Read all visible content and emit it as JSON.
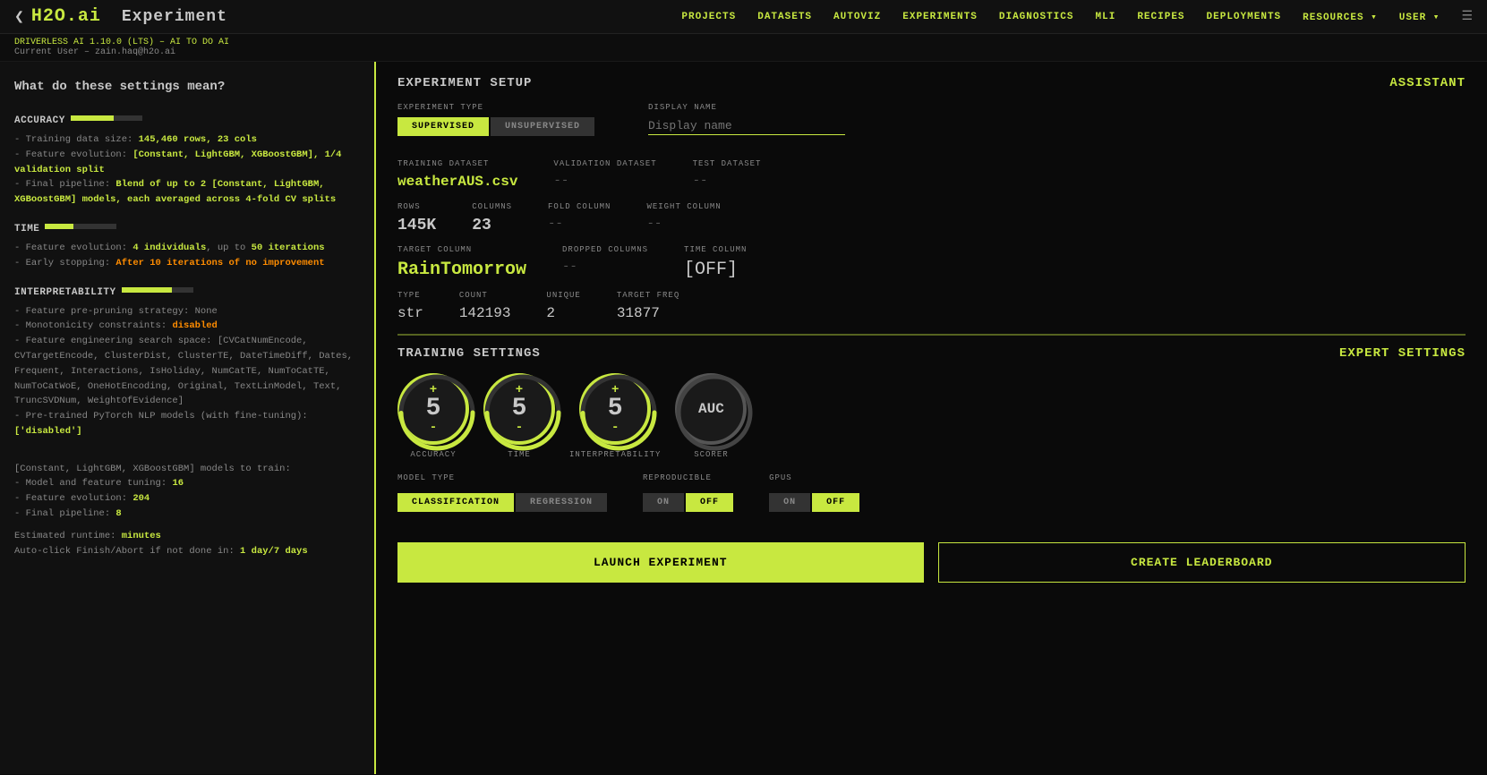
{
  "app": {
    "logo": "H2O.ai",
    "title": "Experiment",
    "version": "DRIVERLESS AI 1.10.0 (LTS) – AI TO DO AI",
    "user": "Current User – zain.haq@h2o.ai"
  },
  "nav": {
    "links": [
      "PROJECTS",
      "DATASETS",
      "AUTOVIZ",
      "EXPERIMENTS",
      "DIAGNOSTICS",
      "MLI",
      "RECIPES",
      "DEPLOYMENTS",
      "RESOURCES ▾",
      "USER ▾"
    ]
  },
  "left_panel": {
    "heading": "What do these settings mean?",
    "accuracy": {
      "label": "ACCURACY",
      "bar_pct": 60,
      "bullets": [
        "Training data size: 145,460 rows, 23 cols",
        "Feature evolution: [Constant, LightGBM, XGBoostGBM], 1/4 validation split",
        "Final pipeline: Blend of up to 2 [Constant, LightGBM, XGBoostGBM] models, each averaged across 4-fold CV splits"
      ]
    },
    "time": {
      "label": "TIME",
      "bar_pct": 40,
      "bullets": [
        "Feature evolution: 4 individuals, up to 50 iterations",
        "Early stopping: After 10 iterations of no improvement"
      ]
    },
    "interpretability": {
      "label": "INTERPRETABILITY",
      "bar_pct": 70,
      "bullets": [
        "Feature pre-pruning strategy: None",
        "Monotonicity constraints: disabled",
        "Feature engineering search space: [CVCatNumEncode, CVTargetEncode, ClusterDist, ClusterTE, DateTimeDiff, Dates, Frequent, Interactions, IsHoliday, NumCatTE, NumToCatTE, NumToCatWoE, OneHotEncoding, Original, TextLinModel, Text, TruncSVDNum, WeightOfEvidence]",
        "Pre-trained PyTorch NLP models (with fine-tuning): ['disabled']"
      ]
    },
    "models": {
      "intro": "[Constant, LightGBM, XGBoostGBM] models to train:",
      "bullets": [
        "Model and feature tuning: 16",
        "Feature evolution: 204",
        "Final pipeline: 8"
      ]
    },
    "runtime": {
      "text": "Estimated runtime: minutes",
      "autoclick": "Auto-click Finish/Abort if not done in: 1 day/7 days"
    }
  },
  "experiment_setup": {
    "title": "EXPERIMENT SETUP",
    "assistant": "ASSISTANT",
    "experiment_type": {
      "label": "EXPERIMENT TYPE",
      "options": [
        "SUPERVISED",
        "UNSUPERVISED"
      ],
      "selected": "SUPERVISED"
    },
    "display_name": {
      "label": "DISPLAY NAME",
      "placeholder": "Display name",
      "value": ""
    },
    "training_dataset": {
      "label": "TRAINING DATASET",
      "value": "weatherAUS.csv"
    },
    "validation_dataset": {
      "label": "VALIDATION DATASET",
      "value": "--"
    },
    "test_dataset": {
      "label": "TEST DATASET",
      "value": "--"
    },
    "rows": {
      "label": "ROWS",
      "value": "145K"
    },
    "columns": {
      "label": "COLUMNS",
      "value": "23"
    },
    "fold_column": {
      "label": "FOLD COLUMN",
      "value": "--"
    },
    "weight_column": {
      "label": "WEIGHT COLUMN",
      "value": "--"
    },
    "target_column": {
      "label": "TARGET COLUMN",
      "value": "RainTomorrow"
    },
    "dropped_columns": {
      "label": "DROPPED COLUMNS",
      "value": "--"
    },
    "time_column": {
      "label": "TIME COLUMN",
      "value": "[OFF]"
    },
    "type": {
      "label": "TYPE",
      "value": "str"
    },
    "count": {
      "label": "COUNT",
      "value": "142193"
    },
    "unique": {
      "label": "UNIQUE",
      "value": "2"
    },
    "target_freq": {
      "label": "TARGET FREQ",
      "value": "31877"
    }
  },
  "training_settings": {
    "title": "TRAINING SETTINGS",
    "expert_settings": "EXPERT SETTINGS",
    "accuracy": {
      "label": "ACCURACY",
      "value": "5",
      "plus": "+",
      "minus": "-"
    },
    "time": {
      "label": "TIME",
      "value": "5",
      "plus": "+",
      "minus": "-"
    },
    "interpretability": {
      "label": "INTERPRETABILITY",
      "value": "5",
      "plus": "+",
      "minus": "-"
    },
    "scorer": {
      "label": "SCORER",
      "value": "AUC"
    },
    "model_type": {
      "label": "MODEL TYPE",
      "options": [
        "CLASSIFICATION",
        "REGRESSION"
      ],
      "selected": "CLASSIFICATION"
    },
    "reproducible": {
      "label": "REPRODUCIBLE",
      "options": [
        "ON",
        "OFF"
      ],
      "selected": "OFF"
    },
    "gpus": {
      "label": "GPUS",
      "options": [
        "ON",
        "OFF"
      ],
      "selected": "OFF"
    }
  },
  "buttons": {
    "launch": "LAUNCH EXPERIMENT",
    "leaderboard": "CREATE LEADERBOARD"
  }
}
